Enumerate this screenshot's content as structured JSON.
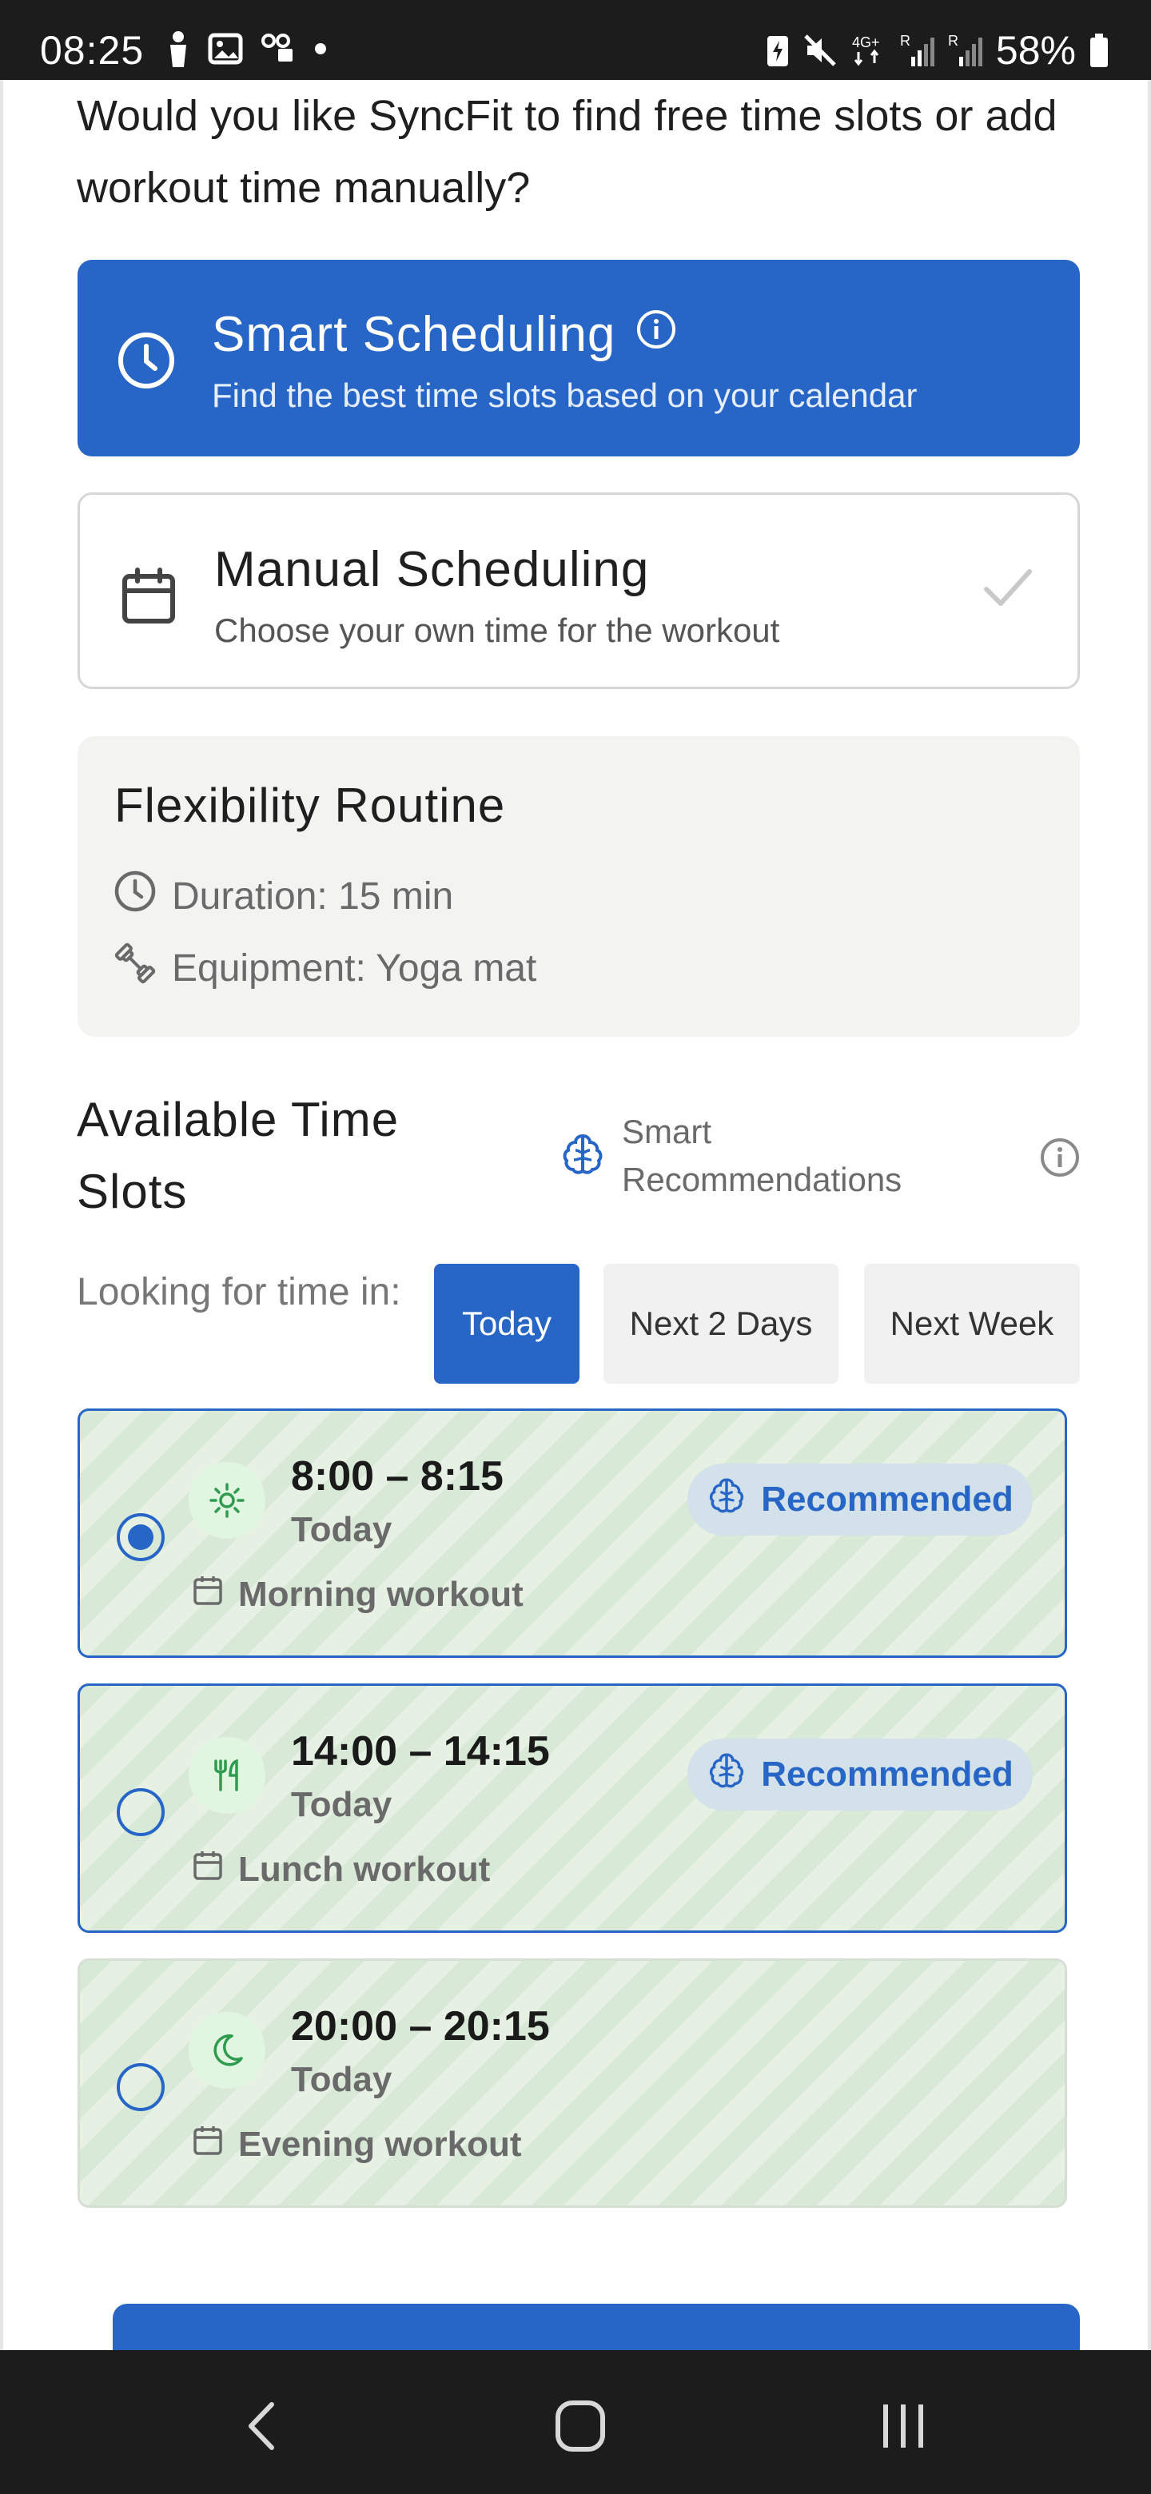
{
  "status_bar": {
    "time": "08:25",
    "battery": "58%",
    "network": "4G+",
    "left_icons": [
      "person-icon",
      "image-icon",
      "voicemail-icon",
      "dot-icon"
    ],
    "right_icons": [
      "battery-saver-icon",
      "mute-icon",
      "signal-icon",
      "signal-icon",
      "battery-icon"
    ]
  },
  "question": "Would you like SyncFit to find free time slots or add workout time manually?",
  "scheduling": {
    "smart": {
      "title": "Smart Scheduling",
      "description": "Find the best time slots based on your calendar",
      "icon": "clock-icon",
      "selected": true
    },
    "manual": {
      "title": "Manual Scheduling",
      "description": "Choose your own time for the workout",
      "icon": "calendar-icon"
    }
  },
  "routine": {
    "title": "Flexibility Routine",
    "duration": "Duration: 15 min",
    "equipment": "Equipment: Yoga mat"
  },
  "slots_section": {
    "title": "Available Time Slots",
    "smart_recommendations": "Smart Recommendations",
    "looking_label": "Looking for time in:",
    "ranges": {
      "today": "Today",
      "next_2_days": "Next 2 Days",
      "next_week": "Next Week"
    },
    "selected_range": "Today"
  },
  "slots": [
    {
      "time": "8:00 – 8:15",
      "day": "Today",
      "type": "Morning workout",
      "icon": "sun-icon",
      "badge": "Recommended",
      "selected": true
    },
    {
      "time": "14:00 – 14:15",
      "day": "Today",
      "type": "Lunch workout",
      "icon": "utensils-icon",
      "badge": "Recommended",
      "selected": false
    },
    {
      "time": "20:00 – 20:15",
      "day": "Today",
      "type": "Evening workout",
      "icon": "moon-icon",
      "badge": "",
      "selected": false
    }
  ],
  "colors": {
    "primary": "#2766c6",
    "slot_green": "#d8e9d8",
    "badge_bg": "#d2e1ea",
    "icon_green": "#2e9b4e"
  }
}
